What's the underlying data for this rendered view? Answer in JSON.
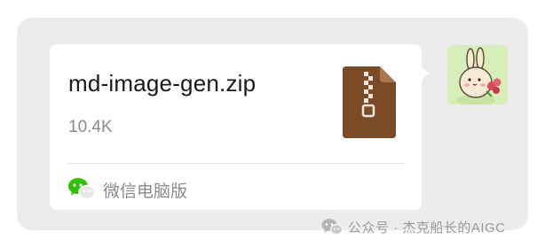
{
  "file_card": {
    "file_name": "md-image-gen.zip",
    "file_size": "10.4K",
    "file_icon": "zip-archive-icon",
    "icon_color": "#7b4a26",
    "source_icon": "wechat-icon",
    "source_label": "微信电脑版"
  },
  "sender": {
    "avatar": "bunny-with-flowers-avatar"
  },
  "watermark": {
    "icon": "wechat-official-account-icon",
    "text": "公众号 · 杰克船长的AIGC"
  },
  "colors": {
    "frame_bg": "#ececec",
    "card_bg": "#ffffff",
    "wechat_green": "#2dc100",
    "secondary_text": "#8a8a8a"
  }
}
